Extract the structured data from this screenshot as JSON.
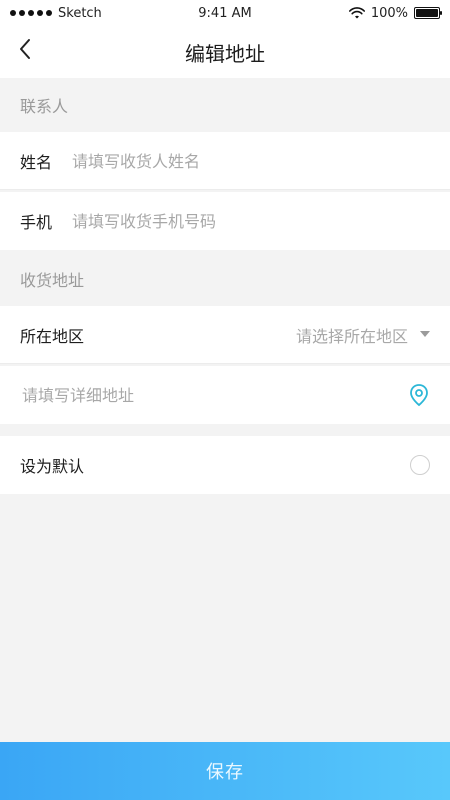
{
  "status_bar": {
    "carrier": "Sketch",
    "time": "9:41 AM",
    "battery": "100%"
  },
  "nav": {
    "title": "编辑地址",
    "back_icon": "chevron-left-icon"
  },
  "contact_section": {
    "title": "联系人",
    "name": {
      "label": "姓名",
      "placeholder": "请填写收货人姓名"
    },
    "phone": {
      "label": "手机",
      "placeholder": "请填写收货手机号码"
    }
  },
  "address_section": {
    "title": "收货地址",
    "region": {
      "label": "所在地区",
      "placeholder": "请选择所在地区",
      "dropdown_icon": "triangle-down-icon"
    },
    "detail": {
      "placeholder": "请填写详细地址",
      "location_icon": "location-pin-icon"
    }
  },
  "default": {
    "label": "设为默认",
    "checked": false
  },
  "footer": {
    "save_label": "保存"
  },
  "colors": {
    "accent_start": "#3aa6f5",
    "accent_end": "#58c8fb",
    "icon_teal": "#2cb7d7"
  }
}
